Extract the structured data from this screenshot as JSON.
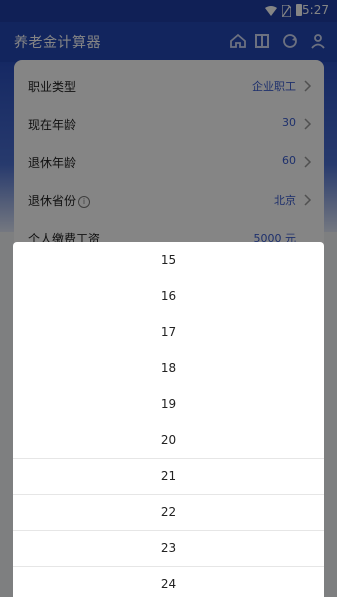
{
  "status_bar": {
    "time": "5:27"
  },
  "app": {
    "title": "养老金计算器"
  },
  "form": {
    "rows": [
      {
        "label": "职业类型",
        "value": "企业职工"
      },
      {
        "label": "现在年龄",
        "value": "30"
      },
      {
        "label": "退休年龄",
        "value": "60"
      },
      {
        "label": "退休省份",
        "value": "北京",
        "info": "i"
      },
      {
        "label": "个人缴费工资",
        "value": "5000 元"
      }
    ]
  },
  "picker": {
    "options": [
      "15",
      "16",
      "17",
      "18",
      "19",
      "20",
      "21",
      "22",
      "23",
      "24"
    ]
  },
  "colors": {
    "primary": "#2347b5",
    "value_text": "#3a5dd0"
  },
  "icons": [
    "wifi-icon",
    "sim-icon",
    "battery-icon",
    "home-icon",
    "grid-icon",
    "sync-icon",
    "user-icon",
    "info-icon",
    "chevron-right-icon"
  ]
}
